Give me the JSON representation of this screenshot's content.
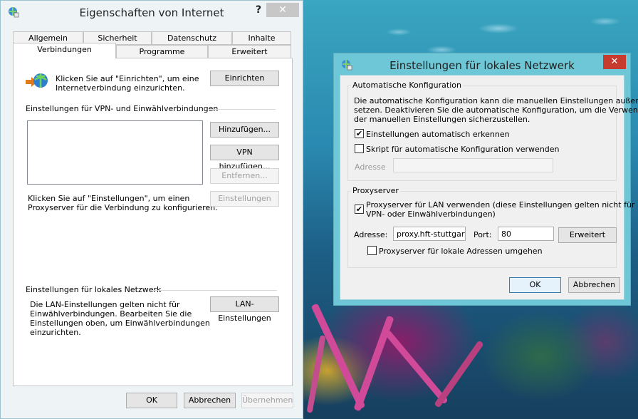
{
  "internet_options": {
    "title": "Eigenschaften von Internet",
    "help": "?",
    "close": "✕",
    "tabs_row1": [
      "Allgemein",
      "Sicherheit",
      "Datenschutz",
      "Inhalte"
    ],
    "tabs_row2": [
      "Verbindungen",
      "Programme",
      "Erweitert"
    ],
    "setup_text_1": "Klicken Sie auf \"Einrichten\", um eine",
    "setup_text_2": "Internetverbindung einzurichten.",
    "setup_button": "Einrichten",
    "vpn_section": "Einstellungen für VPN- und Einwählverbindungen",
    "add_button": "Hinzufügen...",
    "add_vpn_button": "VPN hinzufügen...",
    "remove_button": "Entfernen...",
    "proxy_text_1": "Klicken Sie auf \"Einstellungen\", um einen",
    "proxy_text_2": "Proxyserver für die Verbindung zu konfigurieren.",
    "settings_button": "Einstellungen",
    "lan_section": "Einstellungen für lokales Netzwerk",
    "lan_text_1": "Die LAN-Einstellungen gelten nicht für",
    "lan_text_2": "Einwählverbindungen. Bearbeiten Sie die",
    "lan_text_3": "Einstellungen oben, um Einwählverbindungen",
    "lan_text_4": "einzurichten.",
    "lan_button": "LAN-Einstellungen",
    "ok": "OK",
    "cancel": "Abbrechen",
    "apply": "Übernehmen"
  },
  "lan_settings": {
    "title": "Einstellungen für lokales Netzwerk",
    "close": "✕",
    "auto_group": "Automatische Konfiguration",
    "auto_desc_1": "Die automatische Konfiguration kann die manuellen Einstellungen außer Kraft",
    "auto_desc_2": "setzen. Deaktivieren Sie die automatische Konfiguration, um die Verwendung",
    "auto_desc_3": "der manuellen Einstellungen sicherzustellen.",
    "auto_detect_label": "Einstellungen automatisch erkennen",
    "auto_detect_checked": "✔",
    "script_label": "Skript für automatische Konfiguration verwenden",
    "address_label_disabled": "Adresse",
    "proxy_group": "Proxyserver",
    "use_proxy_label_1": "Proxyserver für LAN verwenden (diese Einstellungen gelten nicht für",
    "use_proxy_label_2": "VPN- oder Einwählverbindungen)",
    "use_proxy_checked": "✔",
    "address_label": "Adresse:",
    "address_value": "proxy.hft-stuttgart",
    "port_label": "Port:",
    "port_value": "80",
    "advanced_button": "Erweitert",
    "bypass_label": "Proxyserver für lokale Adressen umgehen",
    "ok": "OK",
    "cancel": "Abbrechen"
  }
}
